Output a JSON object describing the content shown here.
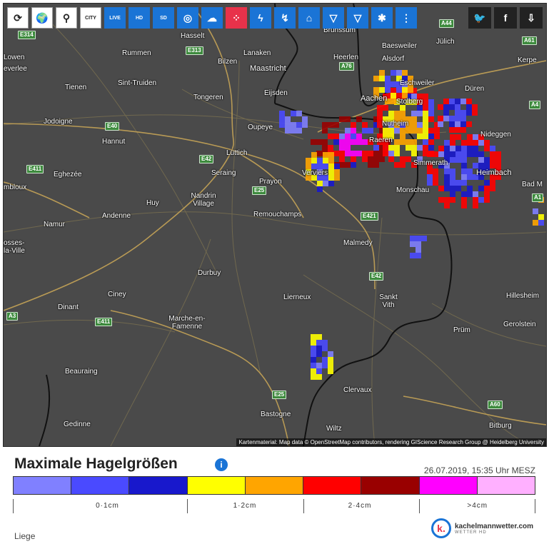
{
  "toolbar": {
    "buttons": [
      {
        "icon": "refresh-icon",
        "glyph": "⟳"
      },
      {
        "icon": "globe-icon",
        "glyph": "🌍"
      },
      {
        "icon": "zoom-icon",
        "glyph": "⚲"
      },
      {
        "icon": "city-icon",
        "label": "CITY"
      },
      {
        "icon": "live-icon",
        "label": "LIVE"
      },
      {
        "icon": "hd-icon",
        "label": "HD"
      },
      {
        "icon": "sd-icon",
        "label": "SD"
      },
      {
        "icon": "radar-icon",
        "glyph": "◎"
      },
      {
        "icon": "cloud-rain-icon",
        "glyph": "☁"
      },
      {
        "icon": "hail-icon",
        "glyph": "⁘"
      },
      {
        "icon": "lightning-icon",
        "glyph": "ϟ"
      },
      {
        "icon": "lightning-track-icon",
        "glyph": "↯"
      },
      {
        "icon": "storm-cell-icon",
        "glyph": "⌂"
      },
      {
        "icon": "tornado-icon",
        "glyph": "▽"
      },
      {
        "icon": "tornado2-icon",
        "glyph": "▽"
      },
      {
        "icon": "satellite-icon",
        "glyph": "✱"
      },
      {
        "icon": "stations-icon",
        "glyph": "⋮"
      }
    ]
  },
  "share": [
    {
      "icon": "twitter-icon",
      "glyph": "🐦"
    },
    {
      "icon": "facebook-icon",
      "glyph": "f"
    },
    {
      "icon": "download-icon",
      "glyph": "⇩"
    }
  ],
  "map": {
    "attribution": "Kartenmaterial: Map data © OpenStreetMap contributors, rendering GIScience Research Group @ Heidelberg University",
    "places": [
      "Hasselt",
      "Rummen",
      "Bilzen",
      "Lanaken",
      "Maastricht",
      "Heerlen",
      "Baesweiler",
      "Jülich",
      "Alsdorf",
      "Lowen",
      "everlee",
      "Tienen",
      "Sint-Truiden",
      "Tongeren",
      "Eijsden",
      "Aachen",
      "Eschweiler",
      "Düren",
      "Stolberg",
      "Kerpe",
      "Jodoigne",
      "Oupeye",
      "Nütheim",
      "Nideggen",
      "Hannut",
      "Lüttich",
      "Raeren",
      "Eghezée",
      "Seraing",
      "Verviers",
      "Simmerath",
      "Heimbach",
      "mbloux",
      "Prayon",
      "Monschau",
      "Bad M",
      "Huy",
      "Nandrin Village",
      "Namur",
      "Andenne",
      "Remouchamps",
      "osses-la-Ville",
      "Malmedy",
      "Durbuy",
      "Ciney",
      "Lierneux",
      "Sankt Vith",
      "Hillesheim",
      "Dinant",
      "Marche-en-Famenne",
      "Gerolstein",
      "Prüm",
      "Beauraing",
      "Clervaux",
      "Bastogne",
      "Bitburg",
      "Gedinne",
      "Wiltz",
      "Brunssum"
    ],
    "roads": [
      "E314",
      "E313",
      "A76",
      "A44",
      "A61",
      "A4",
      "E40",
      "E42",
      "E411",
      "E25",
      "E421",
      "A1",
      "E42",
      "A60",
      "E25",
      "E411",
      "A3"
    ]
  },
  "legend": {
    "title": "Maximale Hagelgrößen",
    "timestamp": "26.07.2019, 15:35 Uhr MESZ",
    "colors": [
      "#8080ff",
      "#4a4aff",
      "#1818cc",
      "#ffff00",
      "#ffa500",
      "#ff0000",
      "#990000",
      "#ff00ff",
      "#ffb0ff"
    ],
    "labels": [
      {
        "text": "0·1cm",
        "pos": 0.181
      },
      {
        "text": "1·2cm",
        "pos": 0.444
      },
      {
        "text": "2·4cm",
        "pos": 0.664
      },
      {
        "text": ">4cm",
        "pos": 0.889
      }
    ],
    "place": "Liege"
  },
  "brand": {
    "logo": "k.",
    "name": "kachelmannwetter.com",
    "sub": "WETTER HD"
  }
}
